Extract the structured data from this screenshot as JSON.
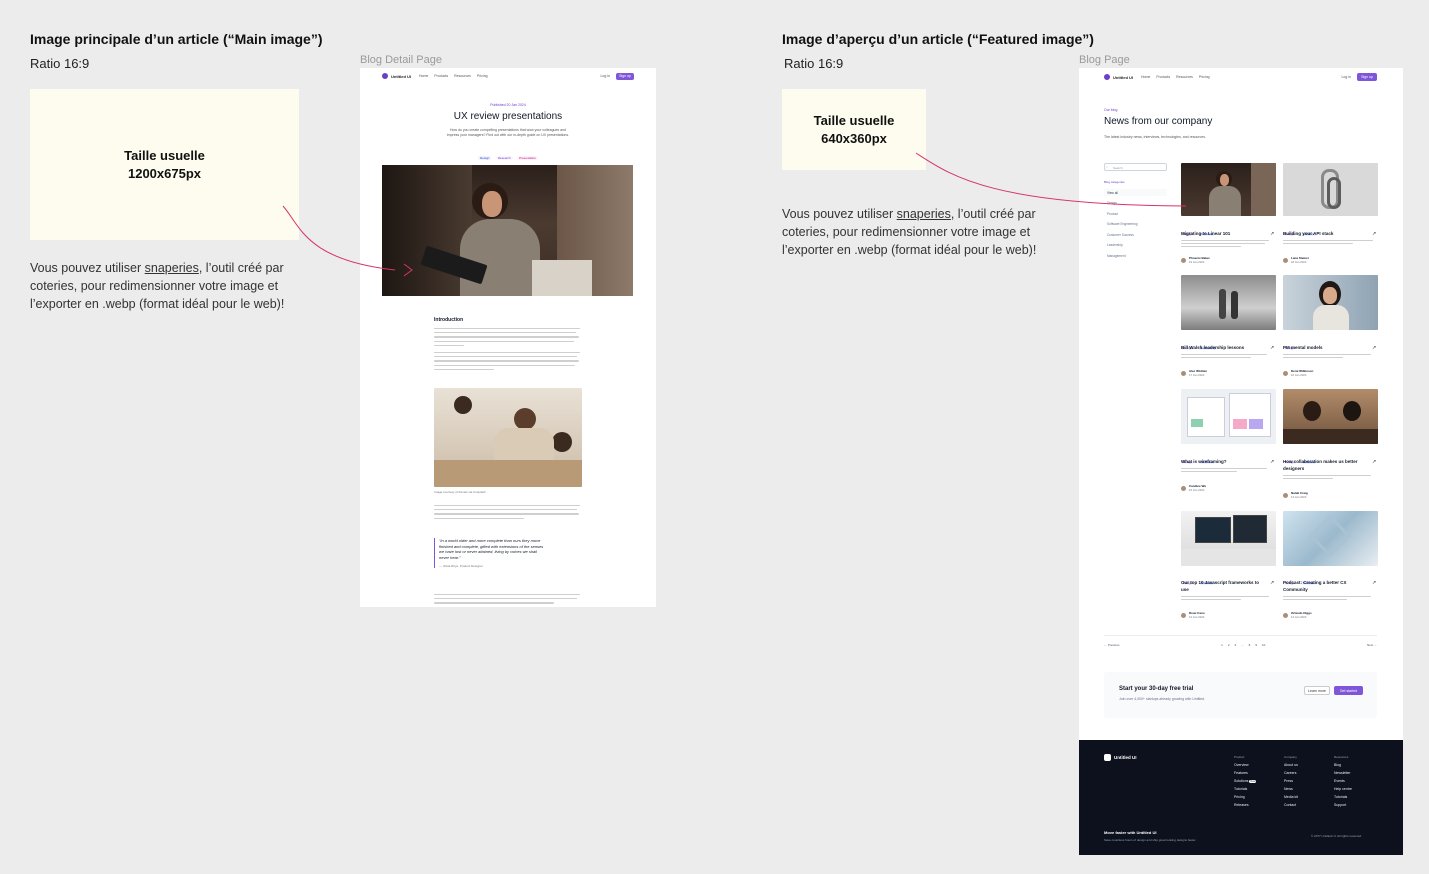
{
  "left": {
    "title": "Image principale d’un article (“Main image”)",
    "ratio": "Ratio 16:9",
    "size_label_1": "Taille usuelle",
    "size_label_2": "1200x675px",
    "note_before": "Vous pouvez utiliser ",
    "note_link": "snaperies",
    "note_after_1": ", l’outil créé par",
    "note_line_2": "coteries, pour redimensionner votre image et",
    "note_line_3": "l’exporter en .webp (format idéal pour le web)!",
    "frame_label": "Blog Detail Page"
  },
  "right": {
    "title": "Image d’aperçu d’un article (“Featured image”)",
    "ratio": "Ratio 16:9",
    "size_label_1": "Taille usuelle",
    "size_label_2": "640x360px",
    "note_before": "Vous pouvez utiliser ",
    "note_link": "snaperies",
    "note_after_1": ", l’outil créé par",
    "note_line_2": "coteries, pour redimensionner votre image et",
    "note_line_3": "l’exporter en .webp (format idéal pour le web)!",
    "frame_label": "Blog Page"
  },
  "detail": {
    "brand": "Untitled UI",
    "nav": [
      "Home",
      "Products",
      "Resources",
      "Pricing"
    ],
    "login": "Log in",
    "signup": "Sign up",
    "date": "Published 20 Jan 2024",
    "headline": "UX review presentations",
    "lede_1": "How do you create compelling presentations that wow your colleagues and",
    "lede_2": "impress your managers? Find out with our in-depth guide on UX presentations.",
    "tags": [
      "Design",
      "Research",
      "Presentation"
    ],
    "section": "Introduction",
    "caption": "Image courtesy of Pexels via Unsplash",
    "quote_1": "“In a world older and more complete than ours they move",
    "quote_2": "finished and complete, gifted with extensions of the senses",
    "quote_3": "we have lost or never attained, living by voices we shall",
    "quote_4": "never hear.”",
    "quote_author": "— Olivia Rhye, Product Designer"
  },
  "blog": {
    "brand": "Untitled UI",
    "nav": [
      "Home",
      "Products",
      "Resources",
      "Pricing"
    ],
    "login": "Log in",
    "signup": "Sign up",
    "eyebrow": "Our blog",
    "headline": "News from our company",
    "sub": "The latest industry news, interviews, technologies, and resources.",
    "search_placeholder": "Search",
    "categories_label": "Blog categories",
    "categories": [
      "View all",
      "Design",
      "Product",
      "Software Engineering",
      "Customer Success",
      "Leadership",
      "Management"
    ],
    "posts": [
      {
        "title": "Migrating to Linear 101",
        "author": "Phoenix Baker",
        "date": "19 Jan 2024",
        "tags": [
          "Design",
          "Software"
        ]
      },
      {
        "title": "Building your API stack",
        "author": "Lana Steiner",
        "date": "18 Jan 2024",
        "tags": [
          "Design",
          "Software"
        ]
      },
      {
        "title": "Bill Walsh leadership lessons",
        "author": "Alec Whitten",
        "date": "17 Jan 2024",
        "tags": [
          "Design",
          "Leadership"
        ]
      },
      {
        "title": "PM mental models",
        "author": "Demi Wilkinson",
        "date": "16 Jan 2024",
        "tags": [
          "Design"
        ]
      },
      {
        "title": "What is wireframing?",
        "author": "Candice Wu",
        "date": "15 Jan 2024",
        "tags": [
          "Design",
          "Software"
        ]
      },
      {
        "title": "How collaboration makes us better designers",
        "author": "Natali Craig",
        "date": "14 Jan 2024",
        "tags": [
          "Design",
          "Software"
        ]
      },
      {
        "title": "Our top 10 Javascript frameworks to use",
        "author": "Drew Cano",
        "date": "13 Jan 2024",
        "tags": [
          "Design",
          "Software"
        ]
      },
      {
        "title": "Podcast: Creating a better CX Community",
        "author": "Orlando Diggs",
        "date": "12 Jan 2024",
        "tags": [
          "Design",
          "Software"
        ]
      }
    ],
    "prev": "Previous",
    "next": "Next",
    "pages": [
      "1",
      "2",
      "3",
      "...",
      "8",
      "9",
      "10"
    ],
    "cta_title": "Start your 30-day free trial",
    "cta_sub": "Join over 4,000+ startups already growing with Untitled.",
    "cta_learn": "Learn more",
    "cta_start": "Get started",
    "footer_brand": "Untitled UI",
    "footer_cols": [
      {
        "heading": "Product",
        "items": [
          "Overview",
          "Features",
          "Solutions",
          "Tutorials",
          "Pricing",
          "Releases"
        ]
      },
      {
        "heading": "Company",
        "items": [
          "About us",
          "Careers",
          "Press",
          "News",
          "Media kit",
          "Contact"
        ]
      },
      {
        "heading": "Resources",
        "items": [
          "Blog",
          "Newsletter",
          "Events",
          "Help centre",
          "Tutorials",
          "Support"
        ]
      }
    ],
    "footer_new": "New",
    "footer_tag": "Move faster with Untitled UI",
    "footer_tag_sub": "Save countless hours of design and ship great looking designs faster.",
    "copyright": "© 2077 Untitled UI. All rights reserved."
  },
  "colors": {
    "accent": "#7f56d9",
    "connector": "#d6336c",
    "cream": "#fdfcef",
    "footer_bg": "#0c111d"
  }
}
